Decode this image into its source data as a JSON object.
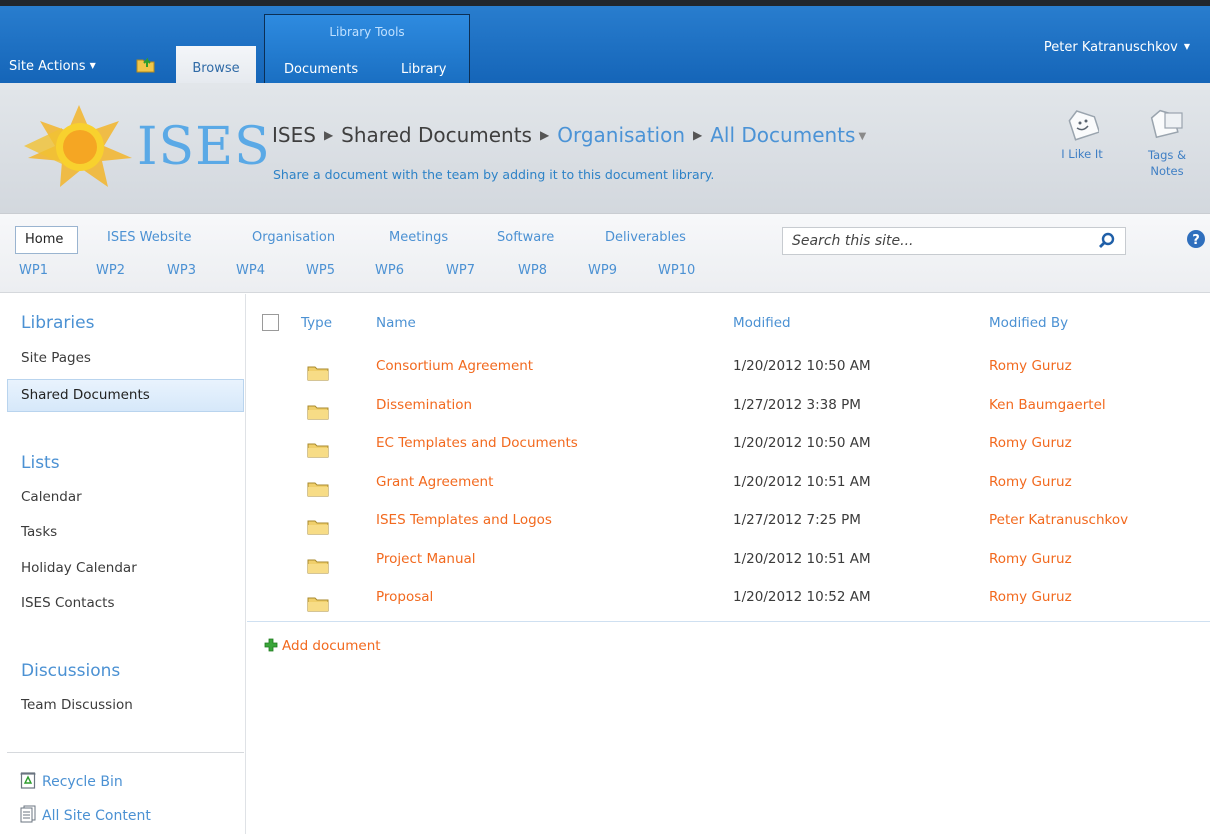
{
  "ribbon": {
    "site_actions": "Site Actions",
    "browse_tab": "Browse",
    "contextual_group": "Library Tools",
    "tabs": [
      "Documents",
      "Library"
    ],
    "user": "Peter Katranuschkov"
  },
  "title_area": {
    "logo_text": "ISES",
    "breadcrumb": {
      "site": "ISES",
      "library": "Shared Documents",
      "folder": "Organisation",
      "view": "All Documents"
    },
    "description": "Share a document with the team by adding it to this document library.",
    "like_label": "I Like It",
    "tags_label": "Tags &\nNotes"
  },
  "topnav": {
    "row1": [
      "Home",
      "ISES Website",
      "Organisation",
      "Meetings",
      "Software",
      "Deliverables"
    ],
    "row2": [
      "WP1",
      "WP2",
      "WP3",
      "WP4",
      "WP5",
      "WP6",
      "WP7",
      "WP8",
      "WP9",
      "WP10"
    ],
    "search_placeholder": "Search this site..."
  },
  "quicklaunch": {
    "libraries_heading": "Libraries",
    "libraries": [
      "Site Pages",
      "Shared Documents"
    ],
    "lists_heading": "Lists",
    "lists": [
      "Calendar",
      "Tasks",
      "Holiday Calendar",
      "ISES Contacts"
    ],
    "discussions_heading": "Discussions",
    "discussions": [
      "Team Discussion"
    ],
    "recycle_bin": "Recycle Bin",
    "all_site_content": "All Site Content"
  },
  "list": {
    "columns": [
      "Type",
      "Name",
      "Modified",
      "Modified By"
    ],
    "rows": [
      {
        "name": "Consortium Agreement",
        "modified": "1/20/2012 10:50 AM",
        "by": "Romy Guruz"
      },
      {
        "name": "Dissemination",
        "modified": "1/27/2012 3:38 PM",
        "by": "Ken Baumgaertel"
      },
      {
        "name": "EC Templates and Documents",
        "modified": "1/20/2012 10:50 AM",
        "by": "Romy Guruz"
      },
      {
        "name": "Grant Agreement",
        "modified": "1/20/2012 10:51 AM",
        "by": "Romy Guruz"
      },
      {
        "name": "ISES Templates and Logos",
        "modified": "1/27/2012 7:25 PM",
        "by": "Peter Katranuschkov"
      },
      {
        "name": "Project Manual",
        "modified": "1/20/2012 10:51 AM",
        "by": "Romy Guruz"
      },
      {
        "name": "Proposal",
        "modified": "1/20/2012 10:52 AM",
        "by": "Romy Guruz"
      }
    ],
    "add_document": "Add document"
  }
}
